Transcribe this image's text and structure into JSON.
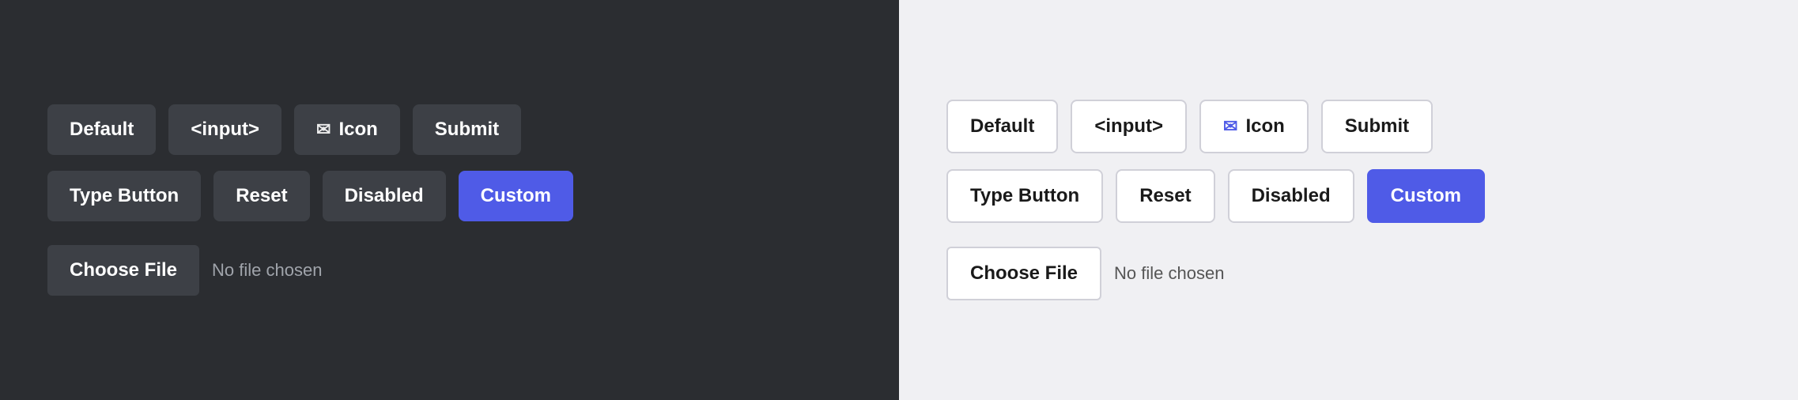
{
  "dark_panel": {
    "row1": {
      "btn1": "Default",
      "btn2": "<input>",
      "btn3_icon": "✉",
      "btn3_label": "Icon",
      "btn4": "Submit"
    },
    "row2": {
      "btn1": "Type Button",
      "btn2": "Reset",
      "btn3": "Disabled",
      "btn4": "Custom"
    },
    "file_row": {
      "choose_label": "Choose File",
      "no_file_text": "No file chosen"
    }
  },
  "light_panel": {
    "row1": {
      "btn1": "Default",
      "btn2": "<input>",
      "btn3_icon": "✉",
      "btn3_label": "Icon",
      "btn4": "Submit"
    },
    "row2": {
      "btn1": "Type Button",
      "btn2": "Reset",
      "btn3": "Disabled",
      "btn4": "Custom"
    },
    "file_row": {
      "choose_label": "Choose File",
      "no_file_text": "No file chosen"
    }
  }
}
